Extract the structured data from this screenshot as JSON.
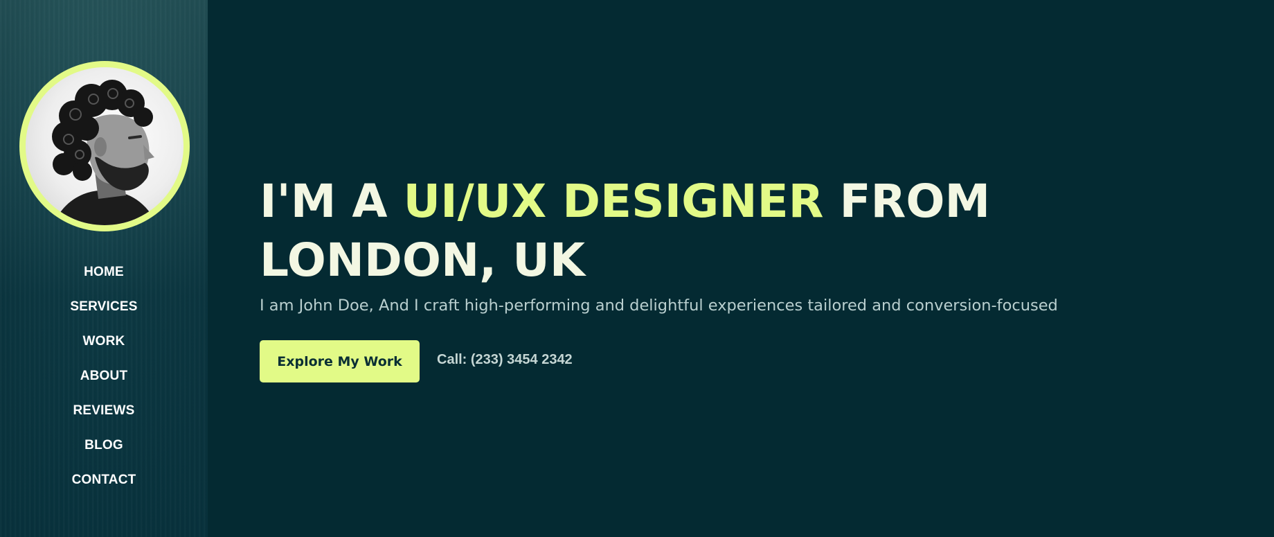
{
  "sidebar": {
    "avatar_alt": "Profile photo of a bearded man with curly hair",
    "nav": [
      "HOME",
      "SERVICES",
      "WORK",
      "ABOUT",
      "REVIEWS",
      "BLOG",
      "CONTACT"
    ]
  },
  "hero": {
    "title_part1": "I'M A ",
    "title_accent": "UI/UX DESIGNER",
    "title_part2": " FROM",
    "title_line2": "LONDON, UK",
    "subtitle": "I am John Doe, And I craft high-performing and delightful experiences tailored and conversion-focused",
    "cta_label": "Explore My Work",
    "call_text": "Call: (233) 3454 2342"
  },
  "colors": {
    "background": "#042a32",
    "accent": "#e2fa87",
    "title": "#f3f7e3",
    "subtitle": "#b9cfcf"
  }
}
